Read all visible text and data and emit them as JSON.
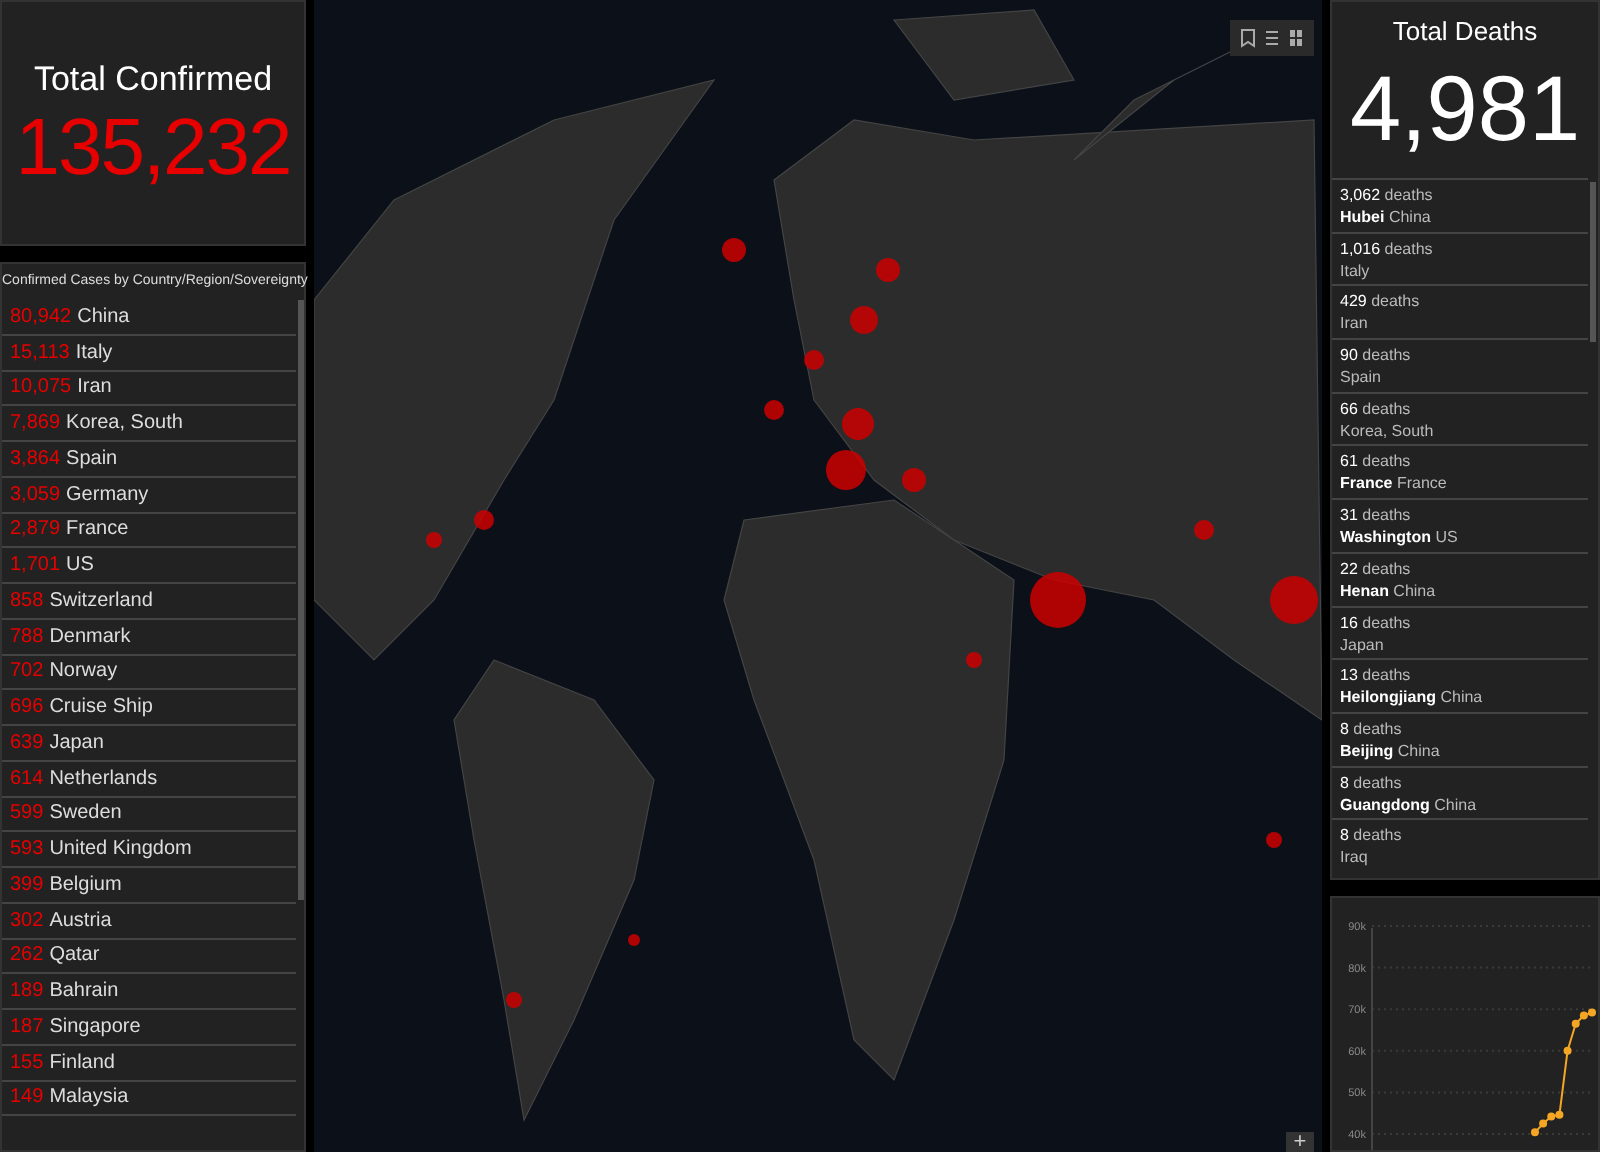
{
  "confirmed": {
    "title": "Total Confirmed",
    "value": "135,232"
  },
  "cases": {
    "title": "Confirmed Cases by Country/Region/Sovereignty",
    "rows": [
      {
        "count": "80,942",
        "place": "China"
      },
      {
        "count": "15,113",
        "place": "Italy"
      },
      {
        "count": "10,075",
        "place": "Iran"
      },
      {
        "count": "7,869",
        "place": "Korea, South"
      },
      {
        "count": "3,864",
        "place": "Spain"
      },
      {
        "count": "3,059",
        "place": "Germany"
      },
      {
        "count": "2,879",
        "place": "France"
      },
      {
        "count": "1,701",
        "place": "US"
      },
      {
        "count": "858",
        "place": "Switzerland"
      },
      {
        "count": "788",
        "place": "Denmark"
      },
      {
        "count": "702",
        "place": "Norway"
      },
      {
        "count": "696",
        "place": "Cruise Ship"
      },
      {
        "count": "639",
        "place": "Japan"
      },
      {
        "count": "614",
        "place": "Netherlands"
      },
      {
        "count": "599",
        "place": "Sweden"
      },
      {
        "count": "593",
        "place": "United Kingdom"
      },
      {
        "count": "399",
        "place": "Belgium"
      },
      {
        "count": "302",
        "place": "Austria"
      },
      {
        "count": "262",
        "place": "Qatar"
      },
      {
        "count": "189",
        "place": "Bahrain"
      },
      {
        "count": "187",
        "place": "Singapore"
      },
      {
        "count": "155",
        "place": "Finland"
      },
      {
        "count": "149",
        "place": "Malaysia"
      }
    ]
  },
  "deaths": {
    "title": "Total Deaths",
    "value": "4,981",
    "rows": [
      {
        "count": "3,062",
        "unit": "deaths",
        "place": "**Hubei** China"
      },
      {
        "count": "1,016",
        "unit": "deaths",
        "place": "Italy"
      },
      {
        "count": "429",
        "unit": "deaths",
        "place": "Iran"
      },
      {
        "count": "90",
        "unit": "deaths",
        "place": "Spain"
      },
      {
        "count": "66",
        "unit": "deaths",
        "place": "Korea, South"
      },
      {
        "count": "61",
        "unit": "deaths",
        "place": "**France** France"
      },
      {
        "count": "31",
        "unit": "deaths",
        "place": "**Washington** US"
      },
      {
        "count": "22",
        "unit": "deaths",
        "place": "**Henan** China"
      },
      {
        "count": "16",
        "unit": "deaths",
        "place": "Japan"
      },
      {
        "count": "13",
        "unit": "deaths",
        "place": "**Heilongjiang** China"
      },
      {
        "count": "8",
        "unit": "deaths",
        "place": "**Beijing** China"
      },
      {
        "count": "8",
        "unit": "deaths",
        "place": "**Guangdong** China"
      },
      {
        "count": "8",
        "unit": "deaths",
        "place": "Iraq"
      }
    ]
  },
  "map": {
    "zoom_in": "+"
  },
  "trend": {
    "chart_data": {
      "type": "line",
      "yticks": [
        {
          "value": 40000,
          "label": "40k"
        },
        {
          "value": 50000,
          "label": "50k"
        },
        {
          "value": 60000,
          "label": "60k"
        },
        {
          "value": 70000,
          "label": "70k"
        },
        {
          "value": 80000,
          "label": "80k"
        },
        {
          "value": 90000,
          "label": "90k"
        }
      ],
      "ylim": [
        40000,
        90000
      ],
      "grid": true,
      "series": [
        {
          "color": "#f5a623",
          "marker": "circle",
          "values": [
            null,
            null,
            null,
            null,
            null,
            null,
            null,
            null,
            null,
            null,
            null,
            null,
            null,
            null,
            null,
            null,
            null,
            null,
            null,
            null,
            40400,
            42500,
            44200,
            44600,
            60000,
            66500,
            68500,
            69200
          ]
        }
      ]
    }
  }
}
